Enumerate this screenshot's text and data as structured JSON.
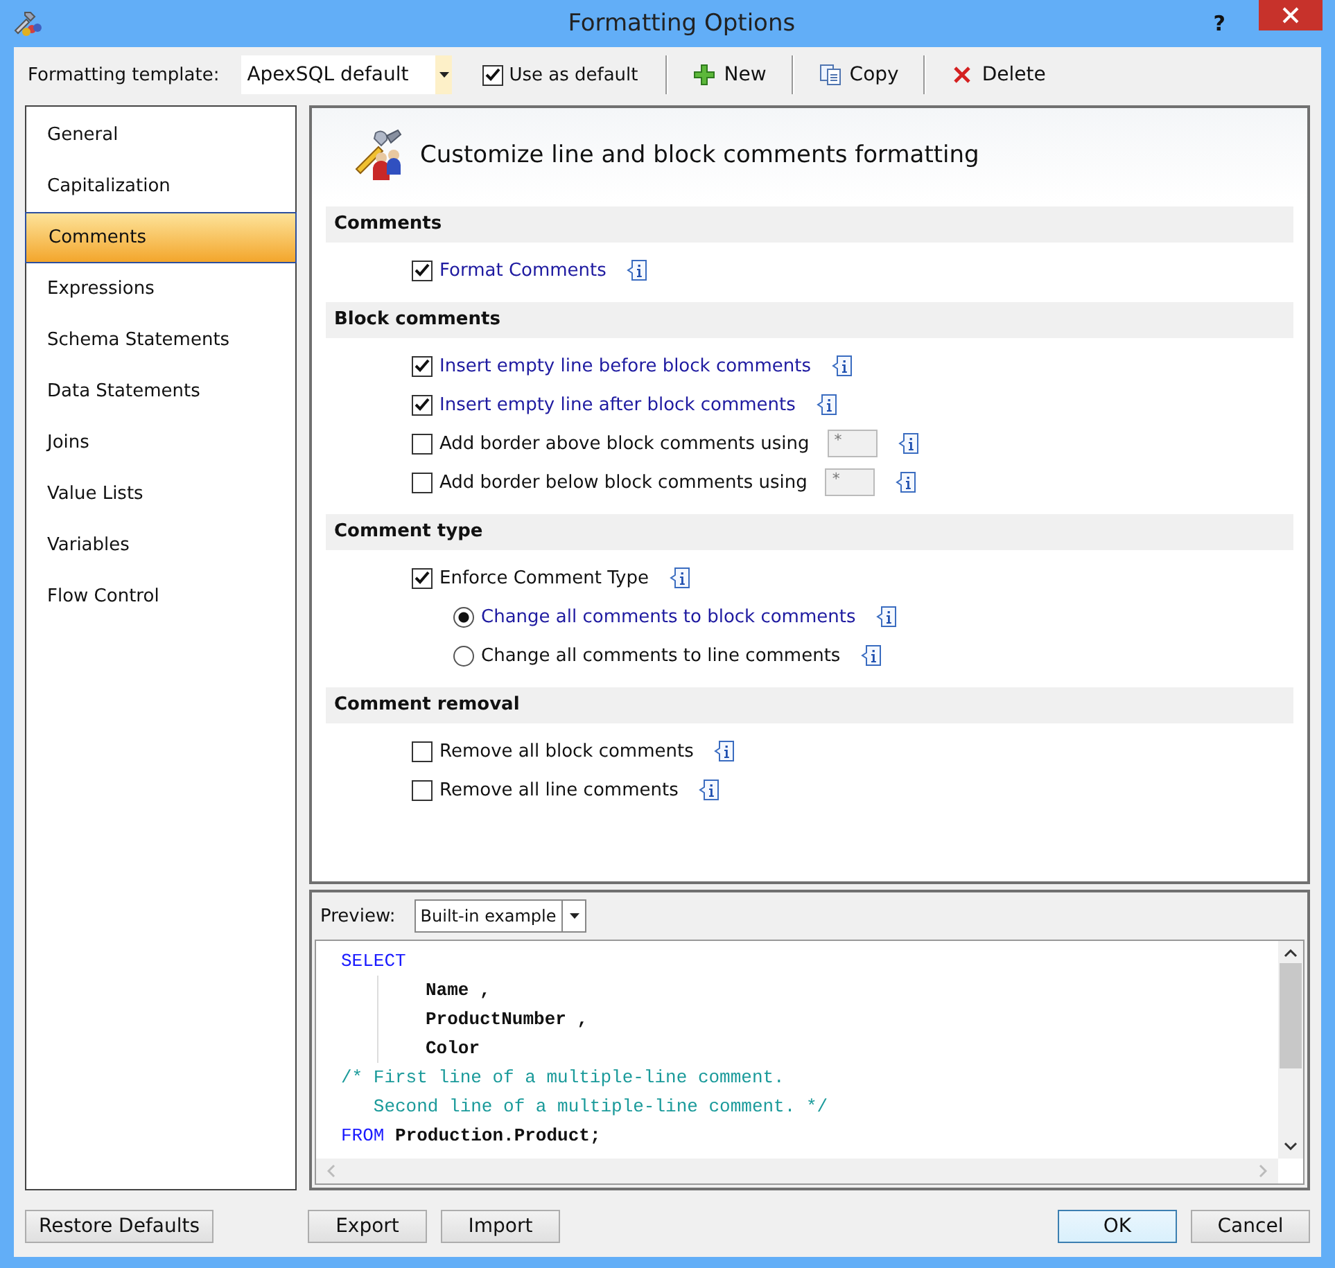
{
  "window": {
    "title": "Formatting Options",
    "help": "?"
  },
  "toolbar": {
    "template_label": "Formatting template:",
    "template_value": "ApexSQL default",
    "use_as_default": {
      "label": "Use as default",
      "checked": true
    },
    "buttons": [
      {
        "kind": "new",
        "label": "New"
      },
      {
        "kind": "copy",
        "label": "Copy"
      },
      {
        "kind": "delete",
        "label": "Delete"
      }
    ]
  },
  "sidebar": {
    "items": [
      {
        "label": "General",
        "selected": false
      },
      {
        "label": "Capitalization",
        "selected": false
      },
      {
        "label": "Comments",
        "selected": true
      },
      {
        "label": "Expressions",
        "selected": false
      },
      {
        "label": "Schema Statements",
        "selected": false
      },
      {
        "label": "Data Statements",
        "selected": false
      },
      {
        "label": "Joins",
        "selected": false
      },
      {
        "label": "Value Lists",
        "selected": false
      },
      {
        "label": "Variables",
        "selected": false
      },
      {
        "label": "Flow Control",
        "selected": false
      }
    ]
  },
  "header": {
    "title": "Customize line and block comments formatting"
  },
  "sections": [
    {
      "title": "Comments",
      "options": [
        {
          "kind": "checkbox",
          "label": "Format Comments",
          "checked": true,
          "modified": true
        }
      ]
    },
    {
      "title": "Block comments",
      "options": [
        {
          "kind": "checkbox",
          "label": "Insert empty line before block comments",
          "checked": true,
          "modified": true
        },
        {
          "kind": "checkbox",
          "label": "Insert empty line after block comments",
          "checked": true,
          "modified": true
        },
        {
          "kind": "checkbox_field",
          "label": "Add border above block comments using",
          "checked": false,
          "modified": false,
          "value": "*"
        },
        {
          "kind": "checkbox_field",
          "label": "Add border below block comments using",
          "checked": false,
          "modified": false,
          "value": "*"
        }
      ]
    },
    {
      "title": "Comment type",
      "options": [
        {
          "kind": "checkbox",
          "label": "Enforce Comment Type",
          "checked": true,
          "modified": false,
          "children": [
            {
              "kind": "radio",
              "label": "Change all comments to block comments",
              "selected": true,
              "modified": true
            },
            {
              "kind": "radio",
              "label": "Change all comments to line comments",
              "selected": false,
              "modified": false
            }
          ]
        }
      ]
    },
    {
      "title": "Comment removal",
      "options": [
        {
          "kind": "checkbox",
          "label": "Remove all block comments",
          "checked": false,
          "modified": false
        },
        {
          "kind": "checkbox",
          "label": "Remove all line comments",
          "checked": false,
          "modified": false
        }
      ]
    }
  ],
  "preview": {
    "label": "Preview:",
    "source": "Built-in example",
    "lines": [
      {
        "indent": false,
        "segments": [
          {
            "kind": "keyword",
            "text": "SELECT"
          }
        ]
      },
      {
        "indent": true,
        "segments": [
          {
            "kind": "ident",
            "text": "Name ,"
          }
        ]
      },
      {
        "indent": true,
        "segments": [
          {
            "kind": "ident",
            "text": "ProductNumber ,"
          }
        ]
      },
      {
        "indent": true,
        "segments": [
          {
            "kind": "ident",
            "text": "Color"
          }
        ]
      },
      {
        "indent": false,
        "segments": [
          {
            "kind": "comment",
            "text": "/* First line of a multiple-line comment."
          }
        ]
      },
      {
        "indent": false,
        "segments": [
          {
            "kind": "comment",
            "text": "   Second line of a multiple-line comment. */"
          }
        ]
      },
      {
        "indent": false,
        "segments": [
          {
            "kind": "keyword",
            "text": "FROM"
          },
          {
            "kind": "ident",
            "text": " Production.Product;"
          }
        ]
      }
    ]
  },
  "footer": {
    "left": [
      {
        "label": "Restore Defaults"
      }
    ],
    "middle": [
      {
        "label": "Export"
      },
      {
        "label": "Import"
      }
    ],
    "right": [
      {
        "label": "OK",
        "default": true
      },
      {
        "label": "Cancel",
        "default": false
      }
    ]
  }
}
